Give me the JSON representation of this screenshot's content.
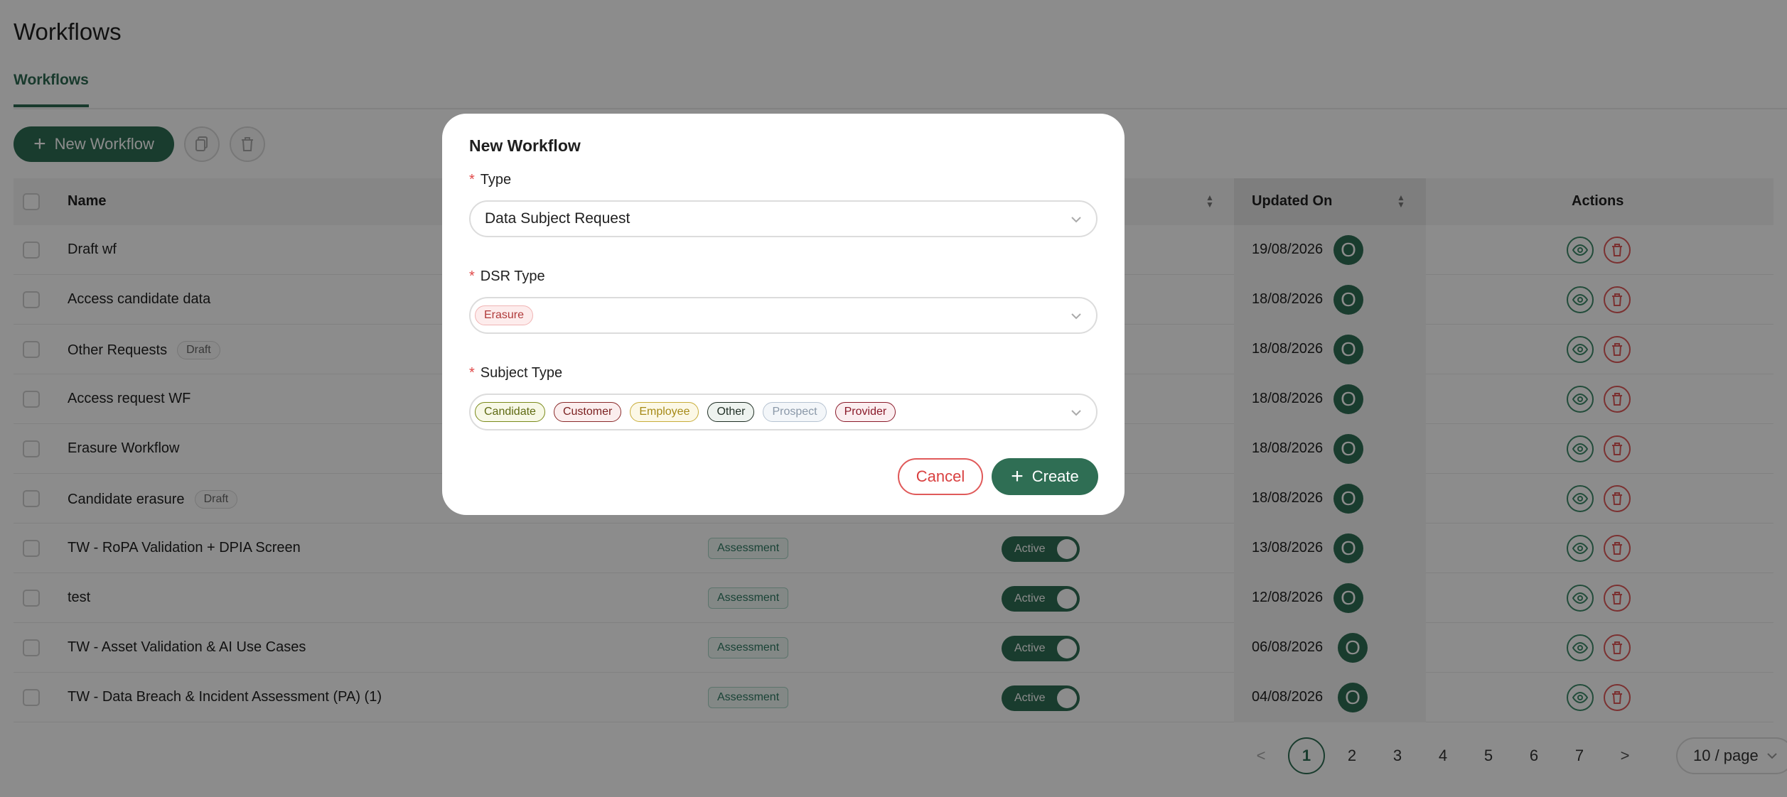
{
  "page": {
    "title": "Workflows",
    "tab_active": "Workflows",
    "new_workflow_label": "New Workflow"
  },
  "table": {
    "columns": {
      "name": "Name",
      "updated_on": "Updated On",
      "actions": "Actions"
    },
    "rows": [
      {
        "name": "Draft wf",
        "draft": "",
        "type": "",
        "status": "",
        "updated": "19/08/2026",
        "avatar": "O"
      },
      {
        "name": "Access candidate data",
        "draft": "",
        "type": "",
        "status": "",
        "updated": "18/08/2026",
        "avatar": "O"
      },
      {
        "name": "Other Requests",
        "draft": "Draft",
        "type": "",
        "status": "",
        "updated": "18/08/2026",
        "avatar": "O"
      },
      {
        "name": "Access request WF",
        "draft": "",
        "type": "",
        "status": "",
        "updated": "18/08/2026",
        "avatar": "O"
      },
      {
        "name": "Erasure Workflow",
        "draft": "",
        "type": "",
        "status": "",
        "updated": "18/08/2026",
        "avatar": "O"
      },
      {
        "name": "Candidate erasure",
        "draft": "Draft",
        "type": "",
        "status": "",
        "updated": "18/08/2026",
        "avatar": "O"
      },
      {
        "name": "TW - RoPA Validation + DPIA Screen",
        "draft": "",
        "type": "Assessment",
        "status": "Active",
        "updated": "13/08/2026",
        "avatar": "O"
      },
      {
        "name": "test",
        "draft": "",
        "type": "Assessment",
        "status": "Active",
        "updated": "12/08/2026",
        "avatar": "O"
      },
      {
        "name": "TW - Asset Validation & AI Use Cases",
        "draft": "",
        "type": "Assessment",
        "status": "Active",
        "updated": "06/08/2026",
        "avatar": "O"
      },
      {
        "name": "TW - Data Breach & Incident Assessment (PA) (1)",
        "draft": "",
        "type": "Assessment",
        "status": "Active",
        "updated": "04/08/2026",
        "avatar": "O"
      }
    ]
  },
  "pagination": {
    "prev": "<",
    "pages": [
      "1",
      "2",
      "3",
      "4",
      "5",
      "6",
      "7"
    ],
    "current": "1",
    "next": ">",
    "page_size": "10 / page"
  },
  "modal": {
    "title": "New Workflow",
    "required_mark": "*",
    "type_label": "Type",
    "type_value": "Data Subject Request",
    "dsr_label": "DSR Type",
    "dsr_values": [
      {
        "label": "Erasure",
        "color": "#b03a3a",
        "bg": "#fdecec",
        "border": "#f0b4b4"
      }
    ],
    "subject_label": "Subject Type",
    "subject_values": [
      {
        "label": "Candidate",
        "color": "#5e6a12",
        "bg": "#f7f8e6",
        "border": "#7a8a1a"
      },
      {
        "label": "Customer",
        "color": "#7a1f1f",
        "bg": "#fbeeee",
        "border": "#8a2a2a"
      },
      {
        "label": "Employee",
        "color": "#a68a17",
        "bg": "#fcf8e6",
        "border": "#c8ad3a"
      },
      {
        "label": "Other",
        "color": "#1f2e24",
        "bg": "#eef3ef",
        "border": "#1f2e24"
      },
      {
        "label": "Prospect",
        "color": "#8a98a8",
        "bg": "#f3f6f9",
        "border": "#b6c3d1"
      },
      {
        "label": "Provider",
        "color": "#8a1a2a",
        "bg": "#fbeef0",
        "border": "#8a1a2a"
      }
    ],
    "cancel_label": "Cancel",
    "create_label": "Create"
  },
  "colors": {
    "primary": "#2f6e54",
    "danger": "#e05a5a"
  },
  "icons": {
    "new": "plus-icon",
    "copy": "copy-icon",
    "delete": "trash-icon",
    "view": "eye-icon",
    "chevron": "chevron-down-icon",
    "sort": "sort-icon"
  }
}
